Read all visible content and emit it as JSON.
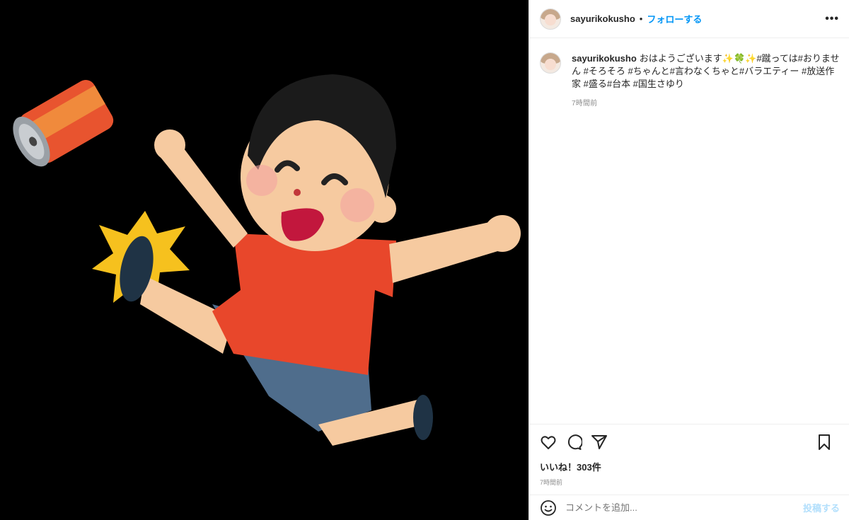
{
  "post": {
    "username": "sayurikokusho",
    "separator": "•",
    "follow_label": "フォローする",
    "more_icon": "more-options-icon"
  },
  "caption": {
    "username": "sayurikokusho",
    "text": "おはようございます✨🍀✨#蹴っては#おりません #そろそろ #ちゃんと#言わなくちゃと#バラエティー #放送作家 #盛る#台本 #国生さゆり",
    "time": "7時間前"
  },
  "actions": {
    "like_icon": "heart-icon",
    "comment_icon": "comment-icon",
    "share_icon": "paper-plane-icon",
    "save_icon": "bookmark-icon"
  },
  "likes": "いいね！303件",
  "post_time": "7時間前",
  "comment": {
    "emoji_icon": "smiley-icon",
    "placeholder": "コメントを追加...",
    "post_label": "投稿する"
  },
  "colors": {
    "accent": "#0095f6",
    "post_disabled": "#b2dffc",
    "muted": "#8e8e8e",
    "media_bg": "#000000"
  }
}
